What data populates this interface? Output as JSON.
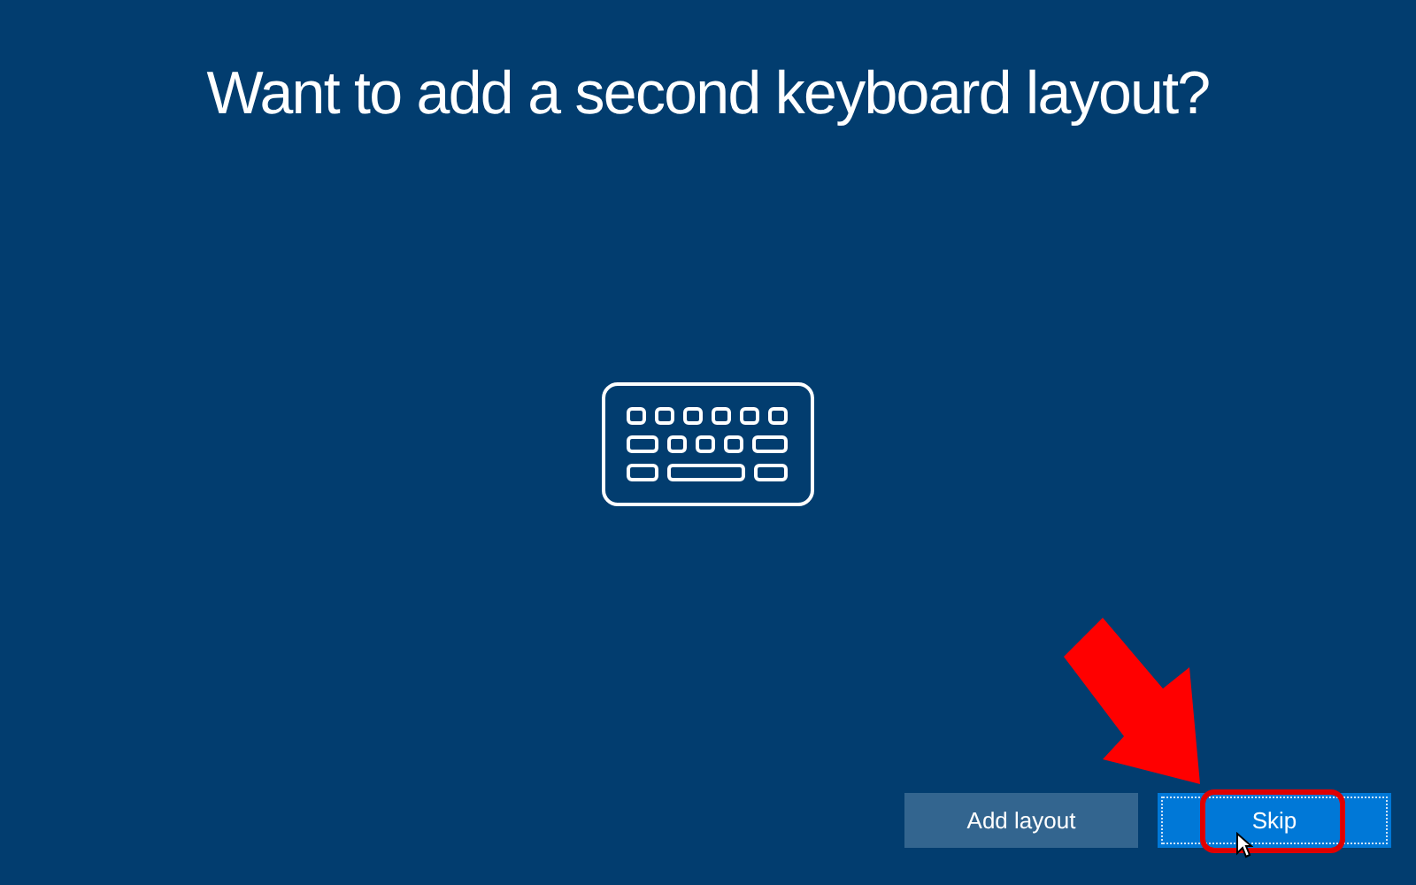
{
  "title": "Want to add a second keyboard layout?",
  "buttons": [
    {
      "label": "Add layout",
      "kind": "secondary",
      "focused": false
    },
    {
      "label": "Skip",
      "kind": "primary",
      "focused": true
    }
  ]
}
